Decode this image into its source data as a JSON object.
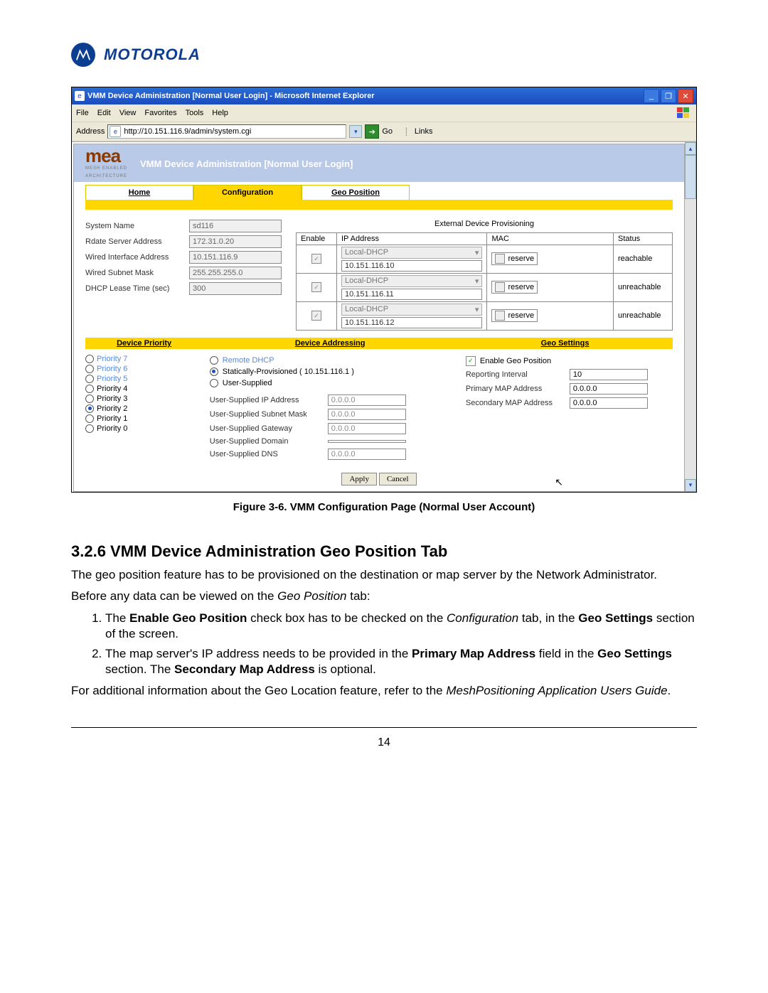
{
  "brand": {
    "name": "MOTOROLA"
  },
  "window": {
    "title": "VMM Device Administration [Normal User Login] - Microsoft Internet Explorer",
    "menu": [
      "File",
      "Edit",
      "View",
      "Favorites",
      "Tools",
      "Help"
    ],
    "address_label": "Address",
    "address_value": "http://10.151.116.9/admin/system.cgi",
    "go_label": "Go",
    "links_label": "Links"
  },
  "appheader": {
    "logo_main": "mea",
    "logo_sub1": "MESH ENABLED",
    "logo_sub2": "ARCHITECTURE",
    "title": "VMM Device Administration [Normal User Login]"
  },
  "tabs": {
    "home": "Home",
    "config": "Configuration",
    "geo": "Geo Position"
  },
  "sysform": {
    "system_name": {
      "label": "System Name",
      "value": "sd116"
    },
    "rdate": {
      "label": "Rdate Server Address",
      "value": "172.31.0.20"
    },
    "wired_if": {
      "label": "Wired Interface Address",
      "value": "10.151.116.9"
    },
    "wired_mask": {
      "label": "Wired Subnet Mask",
      "value": "255.255.255.0"
    },
    "dhcp_lease": {
      "label": "DHCP Lease Time (sec)",
      "value": "300"
    }
  },
  "edp": {
    "title": "External Device Provisioning",
    "cols": {
      "enable": "Enable",
      "ip": "IP Address",
      "mac": "MAC",
      "status": "Status"
    },
    "rows": [
      {
        "sel": "Local-DHCP",
        "ip": "10.151.116.10",
        "mac": "reserve",
        "status": "reachable"
      },
      {
        "sel": "Local-DHCP",
        "ip": "10.151.116.11",
        "mac": "reserve",
        "status": "unreachable"
      },
      {
        "sel": "Local-DHCP",
        "ip": "10.151.116.12",
        "mac": "reserve",
        "status": "unreachable"
      }
    ]
  },
  "panels": {
    "prio_title": "Device Priority",
    "addr_title": "Device Addressing",
    "geo_title": "Geo Settings"
  },
  "priority": {
    "items": [
      "Priority 7",
      "Priority 6",
      "Priority 5",
      "Priority 4",
      "Priority 3",
      "Priority 2",
      "Priority 1",
      "Priority 0"
    ],
    "selected": "Priority 2"
  },
  "addressing": {
    "remote_dhcp": "Remote DHCP",
    "static": "Statically-Provisioned ( 10.151.116.1 )",
    "user_supplied": "User-Supplied",
    "us_ip": {
      "label": "User-Supplied IP Address",
      "value": "0.0.0.0"
    },
    "us_mask": {
      "label": "User-Supplied Subnet Mask",
      "value": "0.0.0.0"
    },
    "us_gw": {
      "label": "User-Supplied Gateway",
      "value": "0.0.0.0"
    },
    "us_domain": {
      "label": "User-Supplied Domain",
      "value": ""
    },
    "us_dns": {
      "label": "User-Supplied DNS",
      "value": "0.0.0.0"
    }
  },
  "geo": {
    "enable": "Enable Geo Position",
    "interval": {
      "label": "Reporting Interval",
      "value": "10"
    },
    "primary": {
      "label": "Primary MAP Address",
      "value": "0.0.0.0"
    },
    "secondary": {
      "label": "Secondary MAP Address",
      "value": "0.0.0.0"
    }
  },
  "buttons": {
    "apply": "Apply",
    "cancel": "Cancel"
  },
  "figure_caption": "Figure 3-6.    VMM Configuration Page (Normal User Account)",
  "doc": {
    "heading": "3.2.6  VMM Device Administration Geo Position Tab",
    "p1": "The geo position feature has to be provisioned on the destination or map server by the Network Administrator.",
    "p2a": "Before any data can be viewed on the ",
    "p2b_i": "Geo Position",
    "p2c": " tab:",
    "li1a": "The ",
    "li1b": "Enable Geo Position",
    "li1c": " check box has to be checked on the ",
    "li1d_i": "Configuration",
    "li1e": " tab, in the ",
    "li1f": "Geo Settings",
    "li1g": " section of the screen.",
    "li2a": "The map server's IP address needs to be provided in the ",
    "li2b": "Primary Map Address",
    "li2c": " field in the ",
    "li2d": "Geo Settings",
    "li2e": " section. The ",
    "li2f": "Secondary Map Address",
    "li2g": " is optional.",
    "p3a": "For additional information about the Geo Location feature, refer to the ",
    "p3b_i": "MeshPositioning Application Users Guide",
    "p3c": ".",
    "pagenum": "14"
  }
}
